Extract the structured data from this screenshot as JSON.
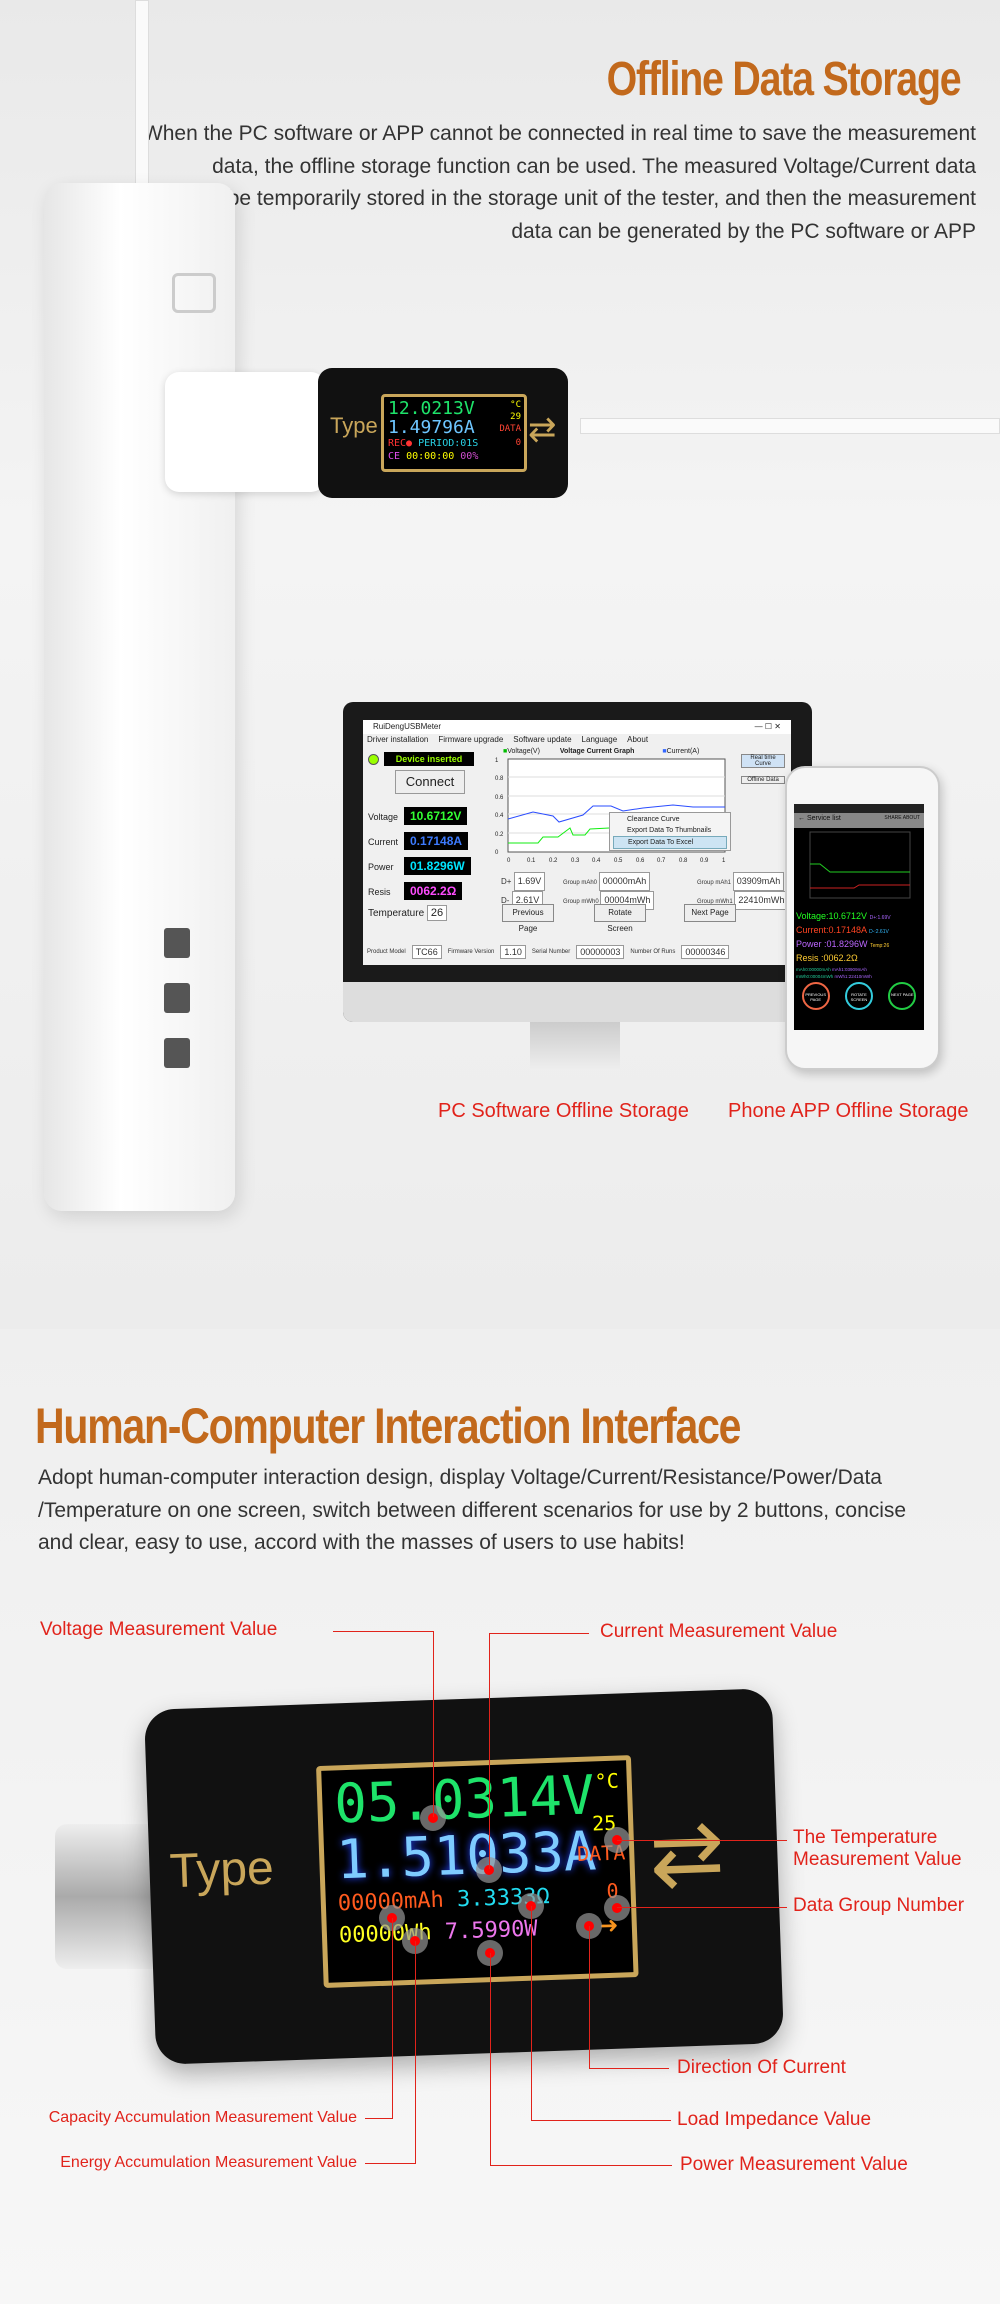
{
  "section1": {
    "title": "Offline Data Storage",
    "paragraph": [
      "When the PC software or APP cannot be connected in real time to save the measurement",
      "data, the offline storage function can be used. The measured Voltage/Current data",
      "can be temporarily stored in the storage unit of the tester, and then the measurement",
      "data can be generated by the PC software or APP"
    ],
    "small_meter": {
      "voltage": "12.0213V",
      "temp_unit": "°C",
      "temp": "29",
      "current": "1.49796A",
      "data_label": "DATA",
      "rec": "REC●",
      "period": "PERIOD:01S",
      "group": "0",
      "ce": "CE",
      "time": "00:00:00",
      "percent": "00%",
      "logo": "Type"
    },
    "software": {
      "app_title": "RuiDengUSBMeter",
      "menu": [
        "Driver installation",
        "Firmware upgrade",
        "Software update",
        "Language",
        "About"
      ],
      "device_status": "Device inserted",
      "connect": "Connect",
      "readings": [
        {
          "label": "Voltage",
          "value": "10.6712V",
          "color": "#33ff33"
        },
        {
          "label": "Current",
          "value": "0.17148A",
          "color": "#3d7bff"
        },
        {
          "label": "Power",
          "value": "01.8296W",
          "color": "#00e5ff"
        },
        {
          "label": "Resis",
          "value": "0062.2Ω",
          "color": "#ff4cff"
        }
      ],
      "temperature_label": "Temperature",
      "temperature": "26",
      "graph_title": "Voltage Current Graph",
      "legend_voltage": "Voltage(V)",
      "legend_current": "Current(A)",
      "y_ticks": [
        "1",
        "0.8",
        "0.6",
        "0.4",
        "0.2",
        "0"
      ],
      "x_ticks": [
        "0",
        "0.1",
        "0.2",
        "0.3",
        "0.4",
        "0.5",
        "0.6",
        "0.7",
        "0.8",
        "0.9",
        "1"
      ],
      "context_menu": [
        "Clearance Curve",
        "Export Data To Thumbnails",
        "Export Data To Excel"
      ],
      "side_buttons": [
        "Real time Curve",
        "Offline Data"
      ],
      "d_plus_label": "D+",
      "d_plus": "1.69V",
      "d_minus_label": "D-",
      "d_minus": "2.61V",
      "group_mah0_label": "Group mAh0",
      "group_mah0": "00000mAh",
      "group_mwh0_label": "Group mWh0",
      "group_mwh0": "00004mWh",
      "group_mah1_label": "Group mAh1",
      "group_mah1": "03909mAh",
      "group_mwh1_label": "Group mWh1",
      "group_mwh1": "22410mWh",
      "nav_buttons": [
        "Previous Page",
        "Rotate Screen",
        "Next Page"
      ],
      "product_model_label": "Product Model",
      "product_model": "TC66",
      "firmware_label": "Firmware Version",
      "firmware": "1.10",
      "serial_label": "Serial Number",
      "serial": "00000003",
      "runs_label": "Number Of Runs",
      "runs": "00000346"
    },
    "phone": {
      "title": "Service list",
      "share": "SHARE",
      "about": "ABOUT",
      "voltage": "Voltage:10.6712V",
      "dplus": "D+:1.69V",
      "current": "Current:0.17148A",
      "dminus": "D-:2.61V",
      "power": "Power  :01.8296W",
      "temp": "Temp:26",
      "resis": "Resis  :0062.2Ω",
      "mah0": "mAh0:00000mAh",
      "mah1": "mAh1:03909mAh",
      "mwh0": "mWh0:00004mWh",
      "mwh1": "mWh1:22410mWh",
      "buttons": [
        "PREVIOUS PAGE",
        "ROTATE SCREEN",
        "NEXT PAGE"
      ]
    },
    "caption_pc": "PC Software Offline Storage",
    "caption_phone": "Phone APP Offline Storage"
  },
  "section2": {
    "title": "Human-Computer Interaction Interface",
    "paragraph": [
      "Adopt human-computer interaction design, display Voltage/Current/Resistance/Power/Data",
      "/Temperature on one screen, switch between different scenarios for use by 2 buttons, concise",
      "and clear, easy to use, accord with the masses of users to use habits!"
    ],
    "meter": {
      "voltage": "05.0314V",
      "temp_unit": "°C",
      "temp": "25",
      "current": "1.51033A",
      "data_label": "DATA",
      "group": "0",
      "mah": "00000mAh",
      "resistance": "3.3333Ω",
      "wh": "00000Wh",
      "power": "7.5990W",
      "logo": "Type"
    },
    "labels": {
      "voltage": "Voltage Measurement Value",
      "current": "Current Measurement Value",
      "temperature": [
        "The Temperature",
        "Measurement Value"
      ],
      "data_group": "Data Group Number",
      "direction": "Direction Of Current",
      "impedance": "Load Impedance Value",
      "power": "Power Measurement Value",
      "capacity": "Capacity Accumulation Measurement Value",
      "energy": "Energy Accumulation Measurement Value"
    }
  },
  "colors": {
    "title": "#c2691c",
    "caption": "#e1231b"
  }
}
